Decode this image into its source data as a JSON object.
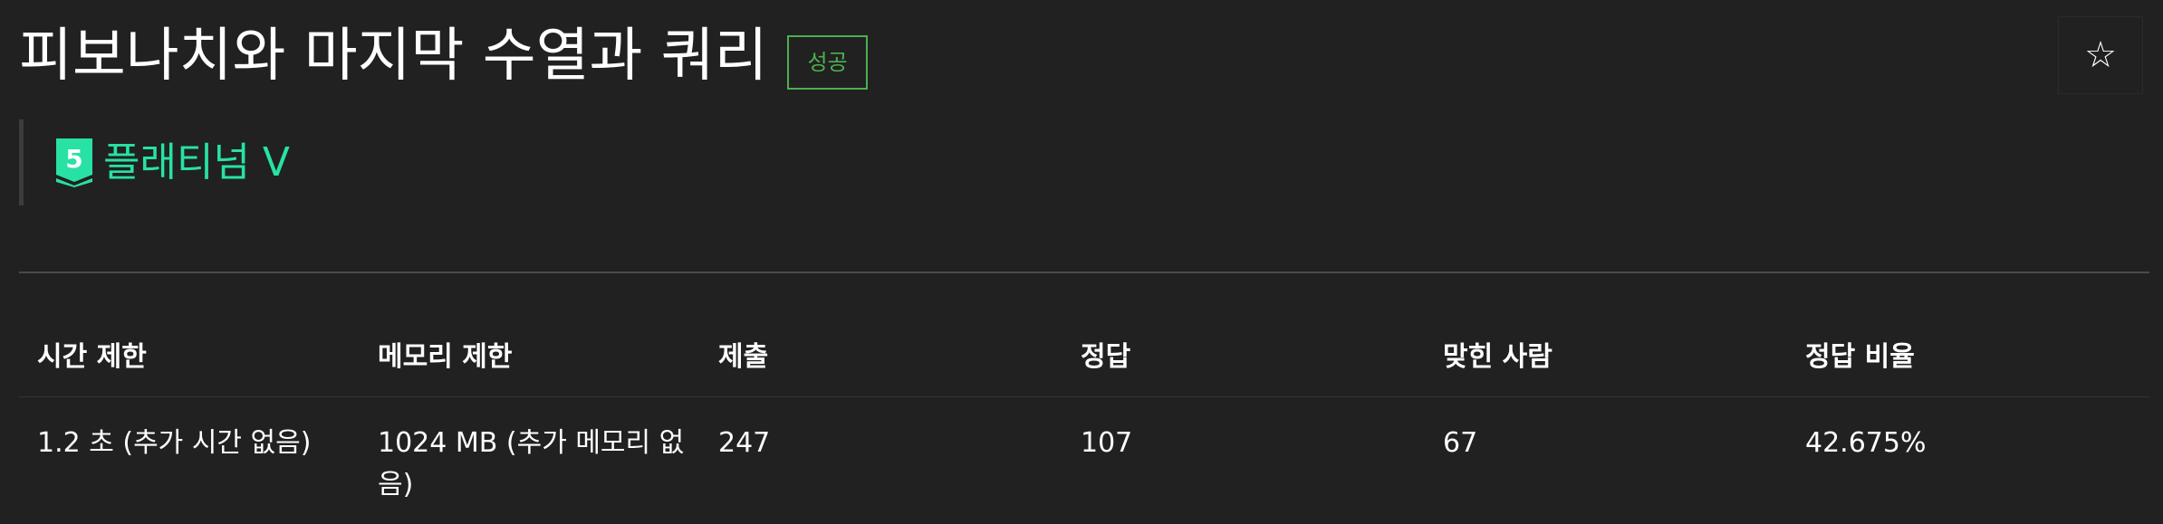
{
  "problem": {
    "title": "피보나치와 마지막 수열과 쿼리",
    "status": "성공",
    "star_glyph": "☆"
  },
  "tier": {
    "number": "5",
    "name": "플래티넘 V",
    "color": "#27e2a4"
  },
  "info_table": {
    "headers": [
      "시간 제한",
      "메모리 제한",
      "제출",
      "정답",
      "맞힌 사람",
      "정답 비율"
    ],
    "values": [
      "1.2 초 (추가 시간 없음)",
      "1024 MB (추가 메모리 없음)",
      "247",
      "107",
      "67",
      "42.675%"
    ]
  }
}
